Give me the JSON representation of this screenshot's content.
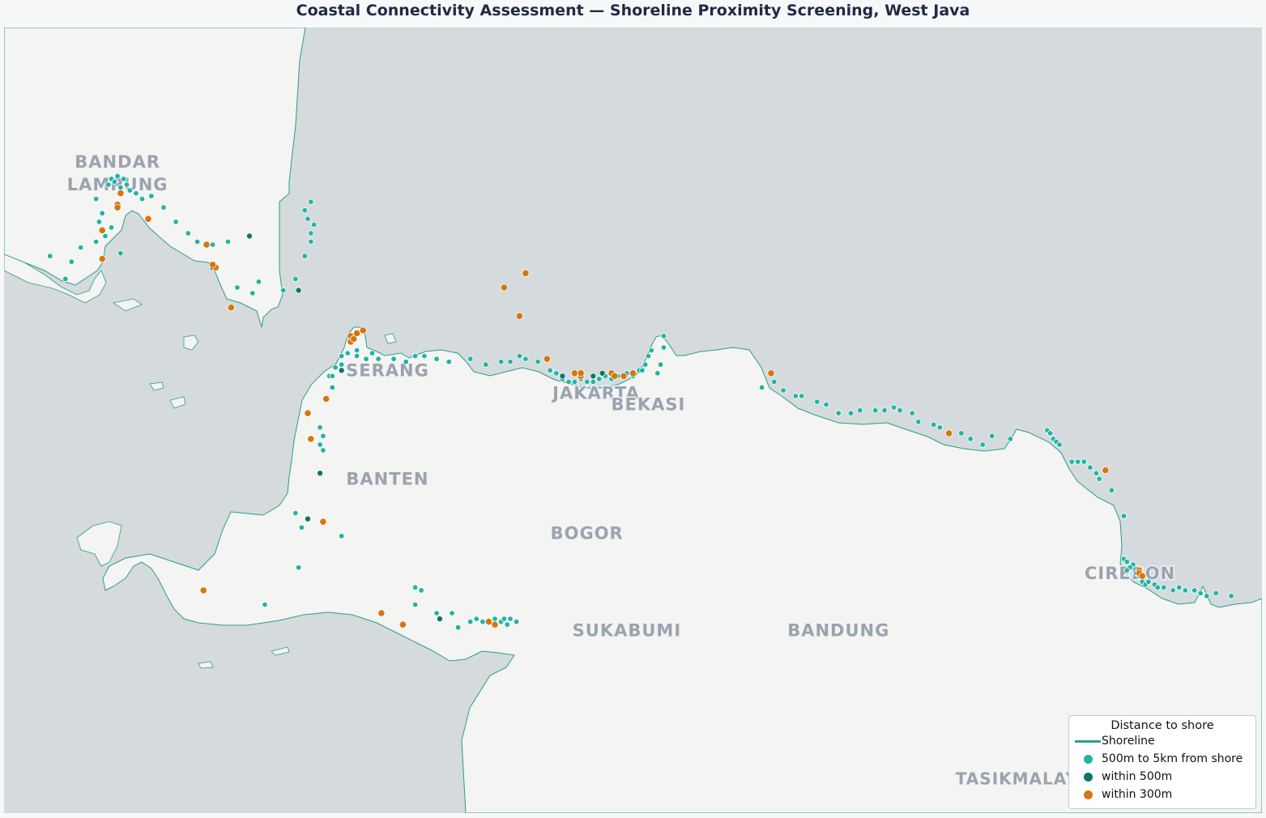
{
  "title": "Coastal Connectivity Assessment — Shoreline Proximity Screening, West Java",
  "colors": {
    "sea": "#d5dadd",
    "land": "#f4f4f2",
    "shoreline": "#2a9d8f",
    "far": "#1fb5a5",
    "near": "#127468",
    "closest": "#d5760f"
  },
  "cities": [
    {
      "name": "BANDAR",
      "lon": 105.27,
      "lat": -5.39
    },
    {
      "name": "LAMPUNG",
      "lon": 105.27,
      "lat": -5.47
    },
    {
      "name": "SERANG",
      "lon": 106.15,
      "lat": -6.12
    },
    {
      "name": "JAKARTA",
      "lon": 106.83,
      "lat": -6.2
    },
    {
      "name": "BEKASI",
      "lon": 107.0,
      "lat": -6.24
    },
    {
      "name": "BANTEN",
      "lon": 106.15,
      "lat": -6.5
    },
    {
      "name": "BOGOR",
      "lon": 106.8,
      "lat": -6.69
    },
    {
      "name": "SUKABUMI",
      "lon": 106.93,
      "lat": -7.03
    },
    {
      "name": "BANDUNG",
      "lon": 107.62,
      "lat": -7.03
    },
    {
      "name": "CIREBON",
      "lon": 108.57,
      "lat": -6.83
    },
    {
      "name": "TASIKMALAYA",
      "lon": 108.22,
      "lat": -7.55
    }
  ],
  "map_data": {
    "extent": {
      "lon": [
        104.9,
        109.0
      ],
      "lat": [
        -7.65,
        -4.9
      ]
    },
    "near_points": [
      [
        105.7,
        -5.63
      ],
      [
        105.58,
        -5.74
      ],
      [
        105.86,
        -5.82
      ],
      [
        106.0,
        -6.1
      ],
      [
        106.72,
        -6.12
      ],
      [
        106.82,
        -6.12
      ],
      [
        106.85,
        -6.11
      ],
      [
        105.93,
        -6.46
      ],
      [
        105.89,
        -6.62
      ],
      [
        106.32,
        -6.97
      ],
      [
        106.48,
        -6.98
      ]
    ],
    "closest_points": [
      [
        105.28,
        -5.48
      ],
      [
        105.27,
        -5.52
      ],
      [
        105.27,
        -5.53
      ],
      [
        105.22,
        -5.61
      ],
      [
        105.22,
        -5.71
      ],
      [
        105.37,
        -5.57
      ],
      [
        105.56,
        -5.66
      ],
      [
        105.59,
        -5.74
      ],
      [
        105.58,
        -5.73
      ],
      [
        105.64,
        -5.88
      ],
      [
        106.03,
        -5.98
      ],
      [
        106.03,
        -6.0
      ],
      [
        106.04,
        -5.99
      ],
      [
        106.05,
        -5.97
      ],
      [
        106.07,
        -5.96
      ],
      [
        105.95,
        -6.2
      ],
      [
        105.89,
        -6.25
      ],
      [
        105.9,
        -6.34
      ],
      [
        105.94,
        -6.63
      ],
      [
        105.55,
        -6.87
      ],
      [
        106.13,
        -6.95
      ],
      [
        106.2,
        -6.99
      ],
      [
        106.48,
        -6.98
      ],
      [
        106.5,
        -6.99
      ],
      [
        106.76,
        -6.11
      ],
      [
        106.78,
        -6.12
      ],
      [
        106.78,
        -6.11
      ],
      [
        106.88,
        -6.11
      ],
      [
        106.89,
        -6.12
      ],
      [
        106.92,
        -6.12
      ],
      [
        106.95,
        -6.11
      ],
      [
        106.67,
        -6.06
      ],
      [
        106.53,
        -5.81
      ],
      [
        106.58,
        -5.91
      ],
      [
        106.6,
        -5.76
      ],
      [
        107.4,
        -6.11
      ],
      [
        107.98,
        -6.32
      ],
      [
        108.49,
        -6.45
      ],
      [
        108.6,
        -6.8
      ],
      [
        108.6,
        -6.81
      ],
      [
        108.61,
        -6.82
      ]
    ],
    "far_points": [
      [
        105.27,
        -5.42
      ],
      [
        105.29,
        -5.43
      ],
      [
        105.25,
        -5.43
      ],
      [
        105.3,
        -5.45
      ],
      [
        105.24,
        -5.45
      ],
      [
        105.28,
        -5.46
      ],
      [
        105.31,
        -5.47
      ],
      [
        105.26,
        -5.44
      ],
      [
        105.33,
        -5.48
      ],
      [
        105.35,
        -5.5
      ],
      [
        105.38,
        -5.49
      ],
      [
        105.42,
        -5.53
      ],
      [
        105.46,
        -5.58
      ],
      [
        105.5,
        -5.62
      ],
      [
        105.53,
        -5.65
      ],
      [
        105.63,
        -5.65
      ],
      [
        105.58,
        -5.66
      ],
      [
        105.9,
        -5.51
      ],
      [
        105.88,
        -5.54
      ],
      [
        105.89,
        -5.57
      ],
      [
        105.91,
        -5.59
      ],
      [
        105.9,
        -5.62
      ],
      [
        105.9,
        -5.65
      ],
      [
        105.88,
        -5.7
      ],
      [
        105.85,
        -5.78
      ],
      [
        105.81,
        -5.82
      ],
      [
        105.73,
        -5.79
      ],
      [
        105.66,
        -5.81
      ],
      [
        105.71,
        -5.83
      ],
      [
        105.25,
        -5.6
      ],
      [
        105.21,
        -5.58
      ],
      [
        105.23,
        -5.63
      ],
      [
        105.2,
        -5.65
      ],
      [
        105.15,
        -5.67
      ],
      [
        105.12,
        -5.72
      ],
      [
        105.05,
        -5.7
      ],
      [
        105.1,
        -5.78
      ],
      [
        105.28,
        -5.69
      ],
      [
        105.2,
        -5.5
      ],
      [
        105.22,
        -5.55
      ],
      [
        106.0,
        -6.05
      ],
      [
        106.02,
        -6.04
      ],
      [
        106.05,
        -6.05
      ],
      [
        106.08,
        -6.06
      ],
      [
        106.1,
        -6.04
      ],
      [
        106.12,
        -6.06
      ],
      [
        106.17,
        -6.06
      ],
      [
        106.21,
        -6.07
      ],
      [
        106.24,
        -6.05
      ],
      [
        106.27,
        -6.05
      ],
      [
        106.31,
        -6.06
      ],
      [
        106.35,
        -6.07
      ],
      [
        106.42,
        -6.06
      ],
      [
        106.47,
        -6.08
      ],
      [
        106.52,
        -6.07
      ],
      [
        106.55,
        -6.07
      ],
      [
        106.58,
        -6.05
      ],
      [
        106.6,
        -6.06
      ],
      [
        106.64,
        -6.07
      ],
      [
        106.68,
        -6.1
      ],
      [
        106.7,
        -6.11
      ],
      [
        106.72,
        -6.13
      ],
      [
        106.74,
        -6.14
      ],
      [
        106.76,
        -6.14
      ],
      [
        106.78,
        -6.13
      ],
      [
        106.8,
        -6.14
      ],
      [
        106.82,
        -6.14
      ],
      [
        106.84,
        -6.13
      ],
      [
        106.86,
        -6.12
      ],
      [
        106.88,
        -6.13
      ],
      [
        106.9,
        -6.12
      ],
      [
        106.93,
        -6.11
      ],
      [
        106.95,
        -6.12
      ],
      [
        106.97,
        -6.1
      ],
      [
        106.99,
        -6.08
      ],
      [
        107.0,
        -6.05
      ],
      [
        107.01,
        -6.03
      ],
      [
        106.98,
        -6.1
      ],
      [
        107.03,
        -6.11
      ],
      [
        107.04,
        -6.08
      ],
      [
        107.05,
        -6.02
      ],
      [
        107.05,
        -5.98
      ],
      [
        106.05,
        -6.03
      ],
      [
        106.0,
        -6.08
      ],
      [
        105.98,
        -6.09
      ],
      [
        105.96,
        -6.12
      ],
      [
        105.97,
        -6.16
      ],
      [
        105.97,
        -6.12
      ],
      [
        105.93,
        -6.3
      ],
      [
        105.94,
        -6.33
      ],
      [
        105.93,
        -6.36
      ],
      [
        105.94,
        -6.38
      ],
      [
        105.85,
        -6.6
      ],
      [
        105.87,
        -6.65
      ],
      [
        106.0,
        -6.68
      ],
      [
        105.86,
        -6.79
      ],
      [
        105.75,
        -6.92
      ],
      [
        106.24,
        -6.86
      ],
      [
        106.26,
        -6.87
      ],
      [
        106.24,
        -6.92
      ],
      [
        106.31,
        -6.95
      ],
      [
        106.38,
        -7.0
      ],
      [
        106.42,
        -6.98
      ],
      [
        106.44,
        -6.97
      ],
      [
        106.46,
        -6.98
      ],
      [
        106.5,
        -6.97
      ],
      [
        106.52,
        -6.98
      ],
      [
        106.53,
        -6.97
      ],
      [
        106.54,
        -6.99
      ],
      [
        106.55,
        -6.97
      ],
      [
        106.57,
        -6.98
      ],
      [
        106.36,
        -6.95
      ],
      [
        107.37,
        -6.16
      ],
      [
        107.41,
        -6.14
      ],
      [
        107.44,
        -6.17
      ],
      [
        107.48,
        -6.19
      ],
      [
        107.5,
        -6.19
      ],
      [
        107.55,
        -6.21
      ],
      [
        107.58,
        -6.22
      ],
      [
        107.62,
        -6.25
      ],
      [
        107.66,
        -6.25
      ],
      [
        107.69,
        -6.24
      ],
      [
        107.74,
        -6.24
      ],
      [
        107.77,
        -6.24
      ],
      [
        107.8,
        -6.23
      ],
      [
        107.82,
        -6.24
      ],
      [
        107.86,
        -6.25
      ],
      [
        107.88,
        -6.28
      ],
      [
        107.93,
        -6.29
      ],
      [
        107.95,
        -6.3
      ],
      [
        108.02,
        -6.32
      ],
      [
        108.05,
        -6.34
      ],
      [
        108.09,
        -6.36
      ],
      [
        108.12,
        -6.33
      ],
      [
        108.18,
        -6.34
      ],
      [
        108.3,
        -6.31
      ],
      [
        108.31,
        -6.32
      ],
      [
        108.32,
        -6.34
      ],
      [
        108.33,
        -6.35
      ],
      [
        108.34,
        -6.36
      ],
      [
        108.38,
        -6.42
      ],
      [
        108.4,
        -6.42
      ],
      [
        108.42,
        -6.42
      ],
      [
        108.44,
        -6.44
      ],
      [
        108.46,
        -6.46
      ],
      [
        108.47,
        -6.48
      ],
      [
        108.51,
        -6.52
      ],
      [
        108.55,
        -6.61
      ],
      [
        108.55,
        -6.76
      ],
      [
        108.56,
        -6.77
      ],
      [
        108.58,
        -6.78
      ],
      [
        108.57,
        -6.79
      ],
      [
        108.59,
        -6.81
      ],
      [
        108.56,
        -6.8
      ],
      [
        108.6,
        -6.82
      ],
      [
        108.61,
        -6.84
      ],
      [
        108.62,
        -6.85
      ],
      [
        108.65,
        -6.85
      ],
      [
        108.68,
        -6.86
      ],
      [
        108.71,
        -6.87
      ],
      [
        108.73,
        -6.86
      ],
      [
        108.75,
        -6.87
      ],
      [
        108.78,
        -6.87
      ],
      [
        108.8,
        -6.88
      ],
      [
        108.82,
        -6.89
      ],
      [
        108.85,
        -6.88
      ],
      [
        108.9,
        -6.89
      ],
      [
        108.63,
        -6.84
      ],
      [
        108.66,
        -6.86
      ]
    ]
  },
  "legend": {
    "title": "Distance to shore",
    "items": [
      {
        "label": "Shoreline",
        "type": "line",
        "color": "#2a9d8f"
      },
      {
        "label": "500m to 5km from shore",
        "type": "dot",
        "color": "#1fb5a5"
      },
      {
        "label": "within 500m",
        "type": "dot",
        "color": "#127468"
      },
      {
        "label": "within 300m",
        "type": "dot",
        "color": "#d5760f"
      }
    ]
  }
}
